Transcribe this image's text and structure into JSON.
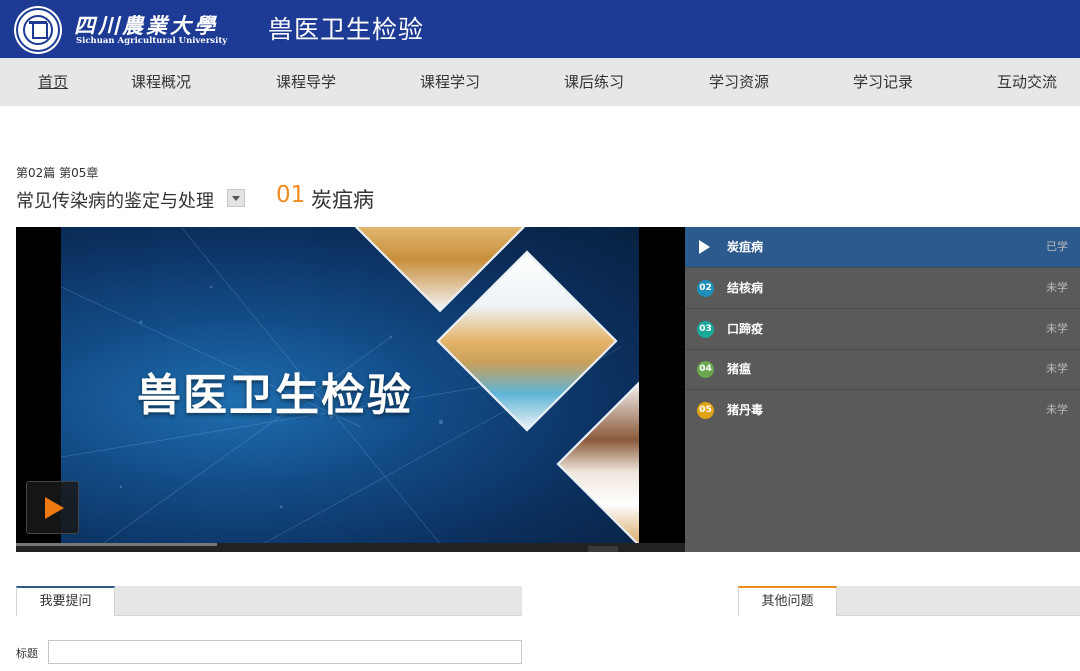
{
  "header": {
    "university_name_cn": "四川農業大學",
    "university_name_en": "Sichuan Agricultural University",
    "site_title": "兽医卫生检验",
    "brand_color": "#1d3a94"
  },
  "nav": {
    "items": [
      {
        "label": "首页",
        "active": true
      },
      {
        "label": "课程概况"
      },
      {
        "label": "课程导学"
      },
      {
        "label": "课程学习"
      },
      {
        "label": "课后练习"
      },
      {
        "label": "学习资源"
      },
      {
        "label": "学习记录"
      },
      {
        "label": "互动交流"
      }
    ]
  },
  "breadcrumb": {
    "chapter": "第02篇 第05章",
    "section": "常见传染病的鉴定与处理",
    "lesson_number": "01",
    "lesson_title": "炭疽病"
  },
  "video": {
    "overlay_title": "兽医卫生检验",
    "play_icon": "play-icon",
    "progress_fraction": 0.3
  },
  "playlist": {
    "items": [
      {
        "badge": "",
        "name": "炭疽病",
        "status": "已学",
        "current": true,
        "color": "#ffffff"
      },
      {
        "badge": "02",
        "name": "结核病",
        "status": "未学",
        "color": "#1e8fb8"
      },
      {
        "badge": "03",
        "name": "口蹄疫",
        "status": "未学",
        "color": "#1aa89a"
      },
      {
        "badge": "04",
        "name": "猪瘟",
        "status": "未学",
        "color": "#6aa84f"
      },
      {
        "badge": "05",
        "name": "猪丹毒",
        "status": "未学",
        "color": "#e0a412"
      }
    ]
  },
  "qa": {
    "ask_tab": "我要提问",
    "other_tab": "其他问题",
    "title_label": "标题",
    "title_value": ""
  },
  "colors": {
    "accent_orange": "#f08b1e",
    "playlist_active": "#2d5a8c",
    "playlist_bg": "#5a5a5a"
  }
}
